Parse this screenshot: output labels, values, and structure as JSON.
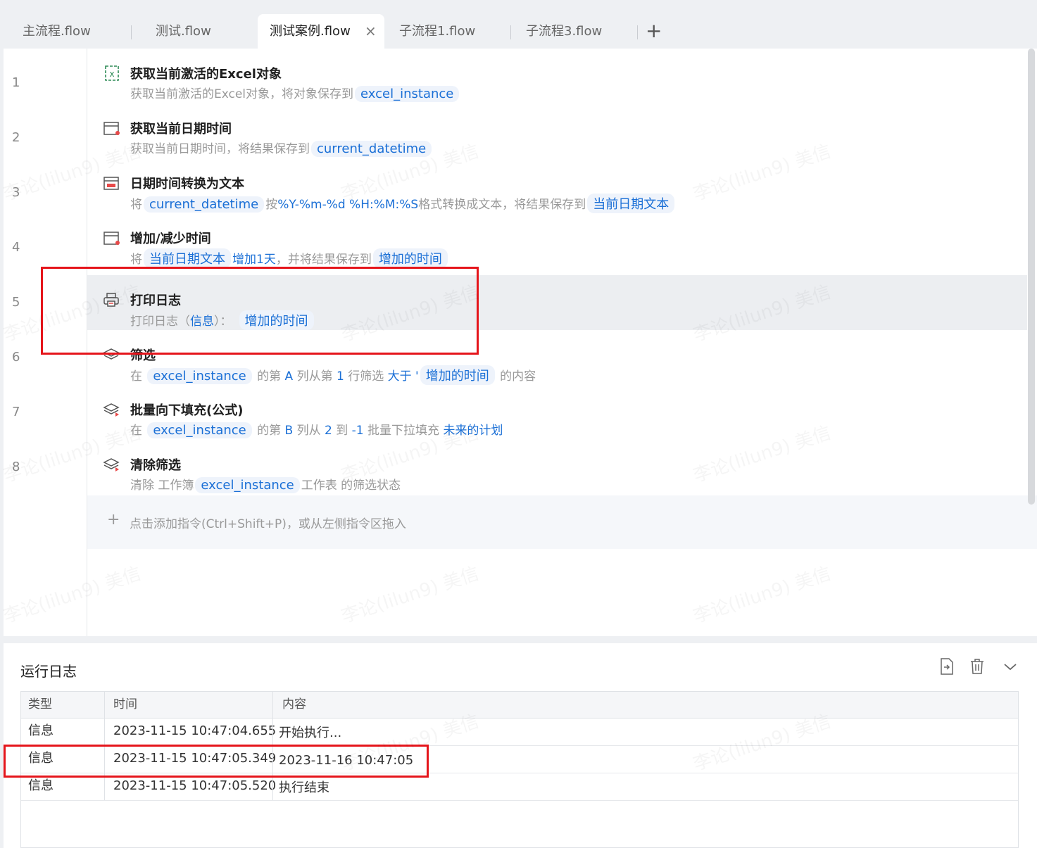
{
  "tabs": [
    {
      "label": "主流程.flow"
    },
    {
      "label": "测试.flow"
    },
    {
      "label": "测试案例.flow",
      "active": true
    },
    {
      "label": "子流程1.flow"
    },
    {
      "label": "子流程3.flow"
    }
  ],
  "tab_close": "×",
  "tab_add": "+",
  "steps": [
    {
      "line": "1",
      "icon": "excel-icon",
      "title": "获取当前激活的Excel对象",
      "desc_prefix": "获取当前激活的Excel对象，将对象保存到",
      "var": "excel_instance"
    },
    {
      "line": "2",
      "icon": "calendar-icon",
      "title": "获取当前日期时间",
      "desc_prefix": "获取当前日期时间，将结果保存到",
      "var": "current_datetime"
    },
    {
      "line": "3",
      "icon": "calendar-icon",
      "title": "日期时间转换为文本",
      "desc_a": "将",
      "var_a": "current_datetime",
      "desc_b": "按",
      "format": "%Y-%m-%d %H:%M:%S",
      "desc_c": "格式转换成文本，将结果保存到",
      "var_b": "当前日期文本"
    },
    {
      "line": "4",
      "icon": "calendar-icon",
      "title": "增加/减少时间",
      "desc_a": "将",
      "var_a": "当前日期文本",
      "amount": "增加1天",
      "desc_b": "，并将结果保存到",
      "var_b": "增加的时间"
    },
    {
      "line": "5",
      "icon": "printer-icon",
      "title": "打印日志",
      "desc_a": "打印日志（",
      "level": "信息",
      "desc_b": "）：",
      "var": "增加的时间"
    },
    {
      "line": "6",
      "icon": "layers-icon",
      "title": "筛选",
      "d1": "在",
      "var_a": "excel_instance",
      "d2": "的第",
      "col": "A",
      "d3": "列从第",
      "rowno": "1",
      "d4": "行筛选",
      "op": "大于 '",
      "var_b": "增加的时间",
      "d5": "的内容"
    },
    {
      "line": "7",
      "icon": "layers-icon",
      "title": "批量向下填充(公式)",
      "d1": "在",
      "var_a": "excel_instance",
      "d2": "的第",
      "col": "B",
      "d3": "列从",
      "from": "2",
      "d4": "到",
      "to": "-1",
      "d5": "批量下拉填充",
      "target": "未来的计划"
    },
    {
      "line": "8",
      "icon": "layers-icon",
      "title": "清除筛选",
      "d1": "清除 工作簿",
      "var_a": "excel_instance",
      "d2": "工作表 的筛选状态"
    }
  ],
  "add_hint": "点击添加指令(Ctrl+Shift+P)，或从左侧指令区拖入",
  "log": {
    "title": "运行日志",
    "headers": [
      "类型",
      "时间",
      "内容"
    ],
    "rows": [
      {
        "type": "信息",
        "time": "2023-11-15 10:47:04.655",
        "content": "开始执行..."
      },
      {
        "type": "信息",
        "time": "2023-11-15 10:47:05.349",
        "content": "2023-11-16 10:47:05"
      },
      {
        "type": "信息",
        "time": "2023-11-15 10:47:05.520",
        "content": "执行结束"
      }
    ]
  },
  "watermark": "李论(lilun9) 美信",
  "colors": {
    "accent": "#1a6fd6",
    "highlight": "#e5151b"
  }
}
